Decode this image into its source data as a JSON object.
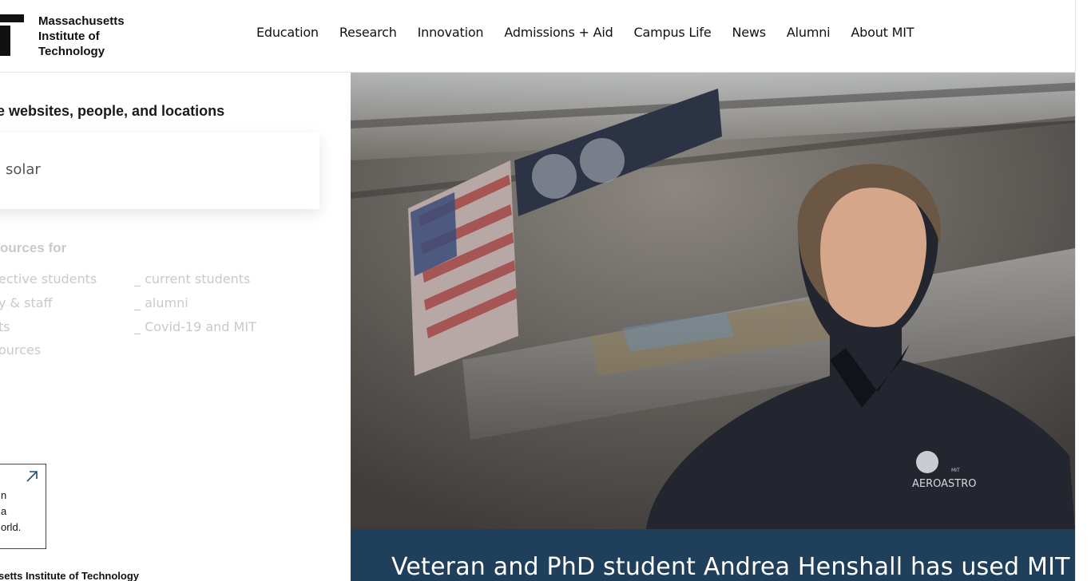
{
  "header": {
    "logo_lines": [
      "Massachusetts",
      "Institute of",
      "Technology"
    ],
    "nav": [
      "Education",
      "Research",
      "Innovation",
      "Admissions + Aid",
      "Campus Life",
      "News",
      "Alumni",
      "About MIT"
    ]
  },
  "left_panel": {
    "search_heading": "e websites, people, and locations",
    "search_value": "solar",
    "resources_heading": "ources for",
    "resources_col1": [
      "ective students",
      "y & staff",
      "ts",
      "ources"
    ],
    "resources_col2": [
      "_ current students",
      "_ alumni",
      "_ Covid-19 and MIT"
    ],
    "promo_lines": [
      "n",
      "a",
      "orld."
    ],
    "footer_name": "setts Institute of Technology"
  },
  "hero": {
    "caption": "Veteran and PhD student Andrea Henshall has used MIT",
    "shirt_logo": "AEROASTRO",
    "shirt_small": "MIT"
  },
  "colors": {
    "caption_bg": "#1f3f5b",
    "promo_border": "#1f4f75",
    "muted_text": "#c9c9c9"
  }
}
